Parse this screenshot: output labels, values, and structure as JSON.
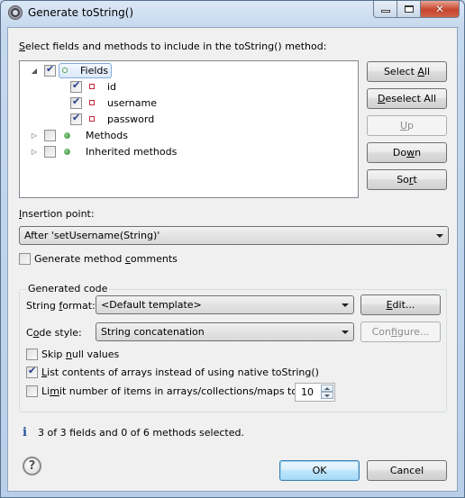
{
  "window": {
    "title": "Generate toString()",
    "controls": {
      "minimize": "minimize",
      "maximize": "maximize",
      "close": "✕"
    }
  },
  "selection": {
    "label_prefix": "S",
    "label_rest": "elect fields and methods to include in the toString() method:",
    "tree": [
      {
        "label": "Fields",
        "expanded": true,
        "checked": true,
        "icon": "field-group-icon",
        "selected": true,
        "level": 0
      },
      {
        "label": "id",
        "checked": true,
        "icon": "private-field-icon",
        "level": 1
      },
      {
        "label": "username",
        "checked": true,
        "icon": "private-field-icon",
        "level": 1
      },
      {
        "label": "password",
        "checked": true,
        "icon": "private-field-icon",
        "level": 1
      },
      {
        "label": "Methods",
        "expanded": false,
        "checked": false,
        "icon": "public-method-icon",
        "level": 0
      },
      {
        "label": "Inherited methods",
        "expanded": false,
        "checked": false,
        "icon": "public-method-icon",
        "level": 0
      }
    ]
  },
  "side_buttons": {
    "select_all": {
      "pre": "Select ",
      "mn": "A",
      "post": "ll"
    },
    "deselect_all": {
      "pre": "",
      "mn": "D",
      "post": "eselect All"
    },
    "up": {
      "pre": "",
      "mn": "U",
      "post": "p"
    },
    "down": {
      "pre": "Do",
      "mn": "w",
      "post": "n"
    },
    "sort": {
      "pre": "So",
      "mn": "r",
      "post": "t"
    }
  },
  "insertion": {
    "label_mn": "I",
    "label_rest": "nsertion point:",
    "value": "After 'setUsername(String)'"
  },
  "method_comments": {
    "pre": "Generate method ",
    "mn": "c",
    "post": "omments",
    "checked": false
  },
  "generated_code": {
    "title": "Generated code",
    "string_format": {
      "pre": "String ",
      "mn": "f",
      "post": "ormat:",
      "value": "<Default template>",
      "edit_pre": "",
      "edit_mn": "E",
      "edit_post": "dit..."
    },
    "code_style": {
      "pre": "C",
      "mn": "o",
      "post": "de style:",
      "value": "String concatenation",
      "configure_pre": "Con",
      "configure_mn": "f",
      "configure_post": "igure..."
    },
    "skip_null": {
      "pre": "Skip ",
      "mn": "n",
      "post": "ull values",
      "checked": false
    },
    "list_arrays": {
      "pre": "",
      "mn": "L",
      "post": "ist contents of arrays instead of using native toString()",
      "checked": true
    },
    "limit_items": {
      "pre": "Li",
      "mn": "m",
      "post": "it number of items in arrays/collections/maps to",
      "checked": false,
      "value": "10"
    }
  },
  "status": {
    "icon": "i",
    "text": "3 of 3 fields and 0 of 6 methods selected."
  },
  "footer": {
    "help": "?",
    "ok": "OK",
    "cancel": "Cancel"
  }
}
